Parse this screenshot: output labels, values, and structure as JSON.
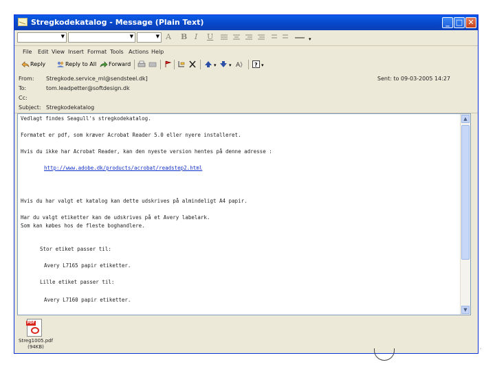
{
  "window": {
    "title": "Stregkodekatalog - Message (Plain Text)",
    "controls": {
      "minimize": "_",
      "maximize": "□",
      "close": "✕"
    }
  },
  "format_toolbar": {
    "font_combo_value": "",
    "size_combo_value": "",
    "buttons": [
      "A",
      "B",
      "I",
      "U"
    ]
  },
  "menu": [
    "File",
    "Edit",
    "View",
    "Insert",
    "Format",
    "Tools",
    "Actions",
    "Help"
  ],
  "toolbar": {
    "reply": "Reply",
    "reply_all": "Reply to All",
    "forward": "Forward"
  },
  "header": {
    "from_label": "From:",
    "from_value": "Stregkode.service_ml@sendsteel.dk]",
    "to_label": "To:",
    "to_value": "tom.leadpetter@softdesign.dk",
    "cc_label": "Cc:",
    "cc_value": "",
    "subject_label": "Subject:",
    "subject_value": "Stregkodekatalog",
    "sent": "Sent: to 09-03-2005 14:27"
  },
  "body_lines": [
    "Vedlagt findes Seagull's stregkodekatalog.",
    "Formatet er pdf, som kræver Acrobat Reader 5.0 eller nyere installeret.",
    "Hvis du ikke har Acrobat Reader, kan den nyeste version hentes på denne adresse :",
    "http://www.adobe.dk/products/acrobat/readstep2.html",
    "Hvis du har valgt et katalog kan dette udskrives på almindeligt A4 papir.",
    "Har du valgt etiketter kan de udskrives på et Avery labelark.",
    "Som kan købes hos de fleste boghandlere.",
    "Stor etiket passer til:",
    "Avery L7165 papir etiketter.",
    "Lille etiket passer til:",
    "Avery L7160 papir etiketter."
  ],
  "attachment": {
    "name": "Streg1005.pdf",
    "size": "(94KB)"
  }
}
